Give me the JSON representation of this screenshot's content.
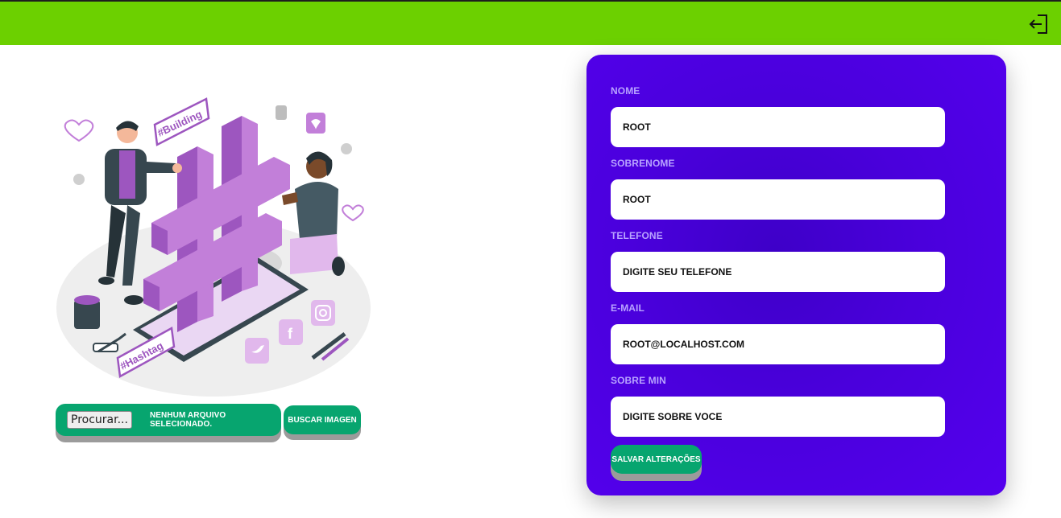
{
  "header": {
    "logout_icon": "logout-icon",
    "background": "#6cd000"
  },
  "illustration": {
    "tag_building": "#Building",
    "tag_hashtag": "#Hashtag"
  },
  "upload": {
    "browse_label": "Procurar...",
    "status": "NENHUM ARQUIVO SELECIONADO.",
    "search_label": "BUSCAR IMAGEN"
  },
  "form": {
    "fields": [
      {
        "label": "NOME",
        "value": "ROOT"
      },
      {
        "label": "SOBRENOME",
        "value": "ROOT"
      },
      {
        "label": "TELEFONE",
        "value": "DIGITE SEU TELEFONE"
      },
      {
        "label": "E-MAIL",
        "value": "ROOT@LOCALHOST.COM"
      },
      {
        "label": "SOBRE MIN",
        "value": "DIGITE SOBRE VOCE"
      }
    ],
    "save_label": "SALVAR ALTERAÇÕES"
  },
  "colors": {
    "accent_green": "#07a56f",
    "panel_purple": "#4a00dc",
    "topbar_green": "#6cd000",
    "hashtag_purple": "#c27fd9"
  }
}
